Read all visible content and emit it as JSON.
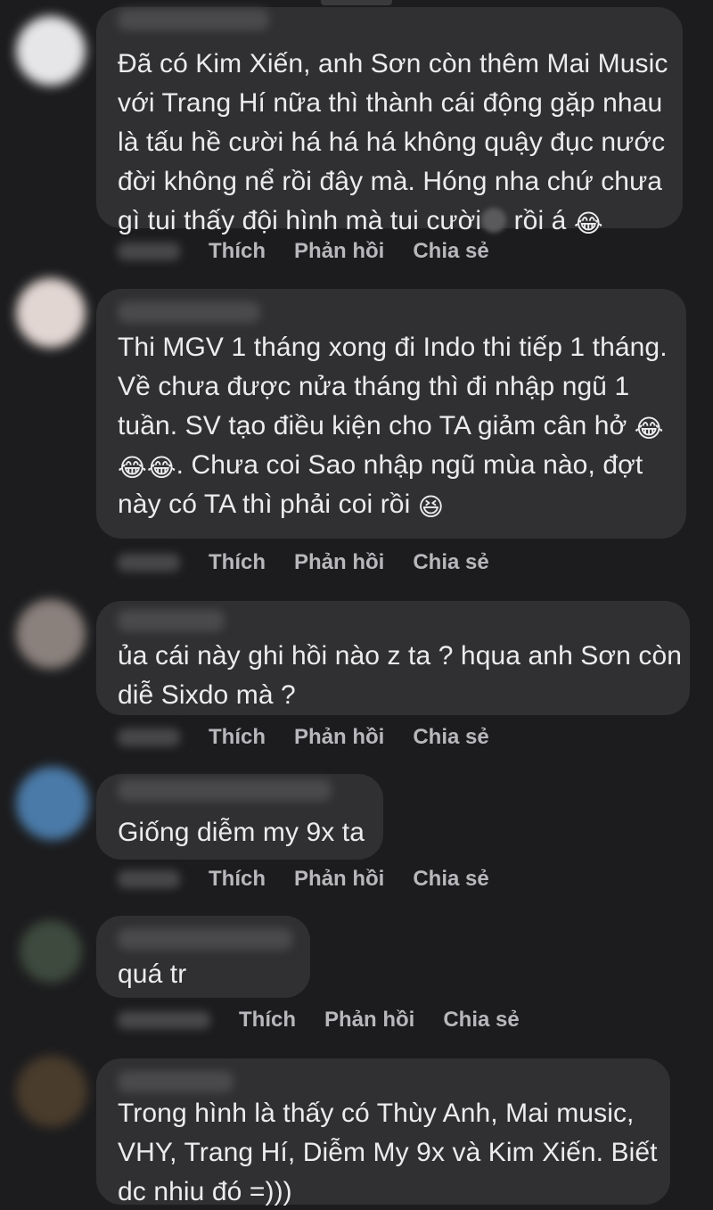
{
  "comments": [
    {
      "text": "Đã có Kim Xiến, anh Sơn còn thêm Mai Music\nvới Trang Hí nữa thì thành cái động gặp nhau\nlà tấu hề cười há há há không quậy đục nước\nđời không nể rồi đây mà. Hóng nha chứ chưa\ngì tui thấy đội hình mà tui cười",
      "text_tail": "rồi á",
      "emoji_tail": "😂"
    },
    {
      "text": "Thi MGV 1 tháng xong đi Indo thi tiếp 1 tháng.\nVề chưa được nửa tháng thì đi nhập ngũ 1\ntuần. SV tạo điều kiện cho TA giảm cân hở",
      "line4_emoji": "😂😂",
      "line4_text": ". Chưa coi Sao nhập ngũ mùa nào, đợt",
      "line5_text": "này có TA thì phải coi rồi",
      "emoji_tail": "😆",
      "emoji_line3": "😂"
    },
    {
      "text": "ủa cái này ghi hồi nào z ta ? hqua anh Sơn còn\ndiễ Sixdo mà ?"
    },
    {
      "text": "Giống diễm my 9x ta"
    },
    {
      "text": "quá tr"
    },
    {
      "text": "Trong hình là thấy có Thùy Anh, Mai music,\nVHY, Trang Hí, Diễm My 9x và Kim Xiến. Biết\ndc nhiu đó =)))"
    }
  ],
  "actions": {
    "like": "Thích",
    "reply": "Phản hồi",
    "share": "Chia sẻ"
  }
}
